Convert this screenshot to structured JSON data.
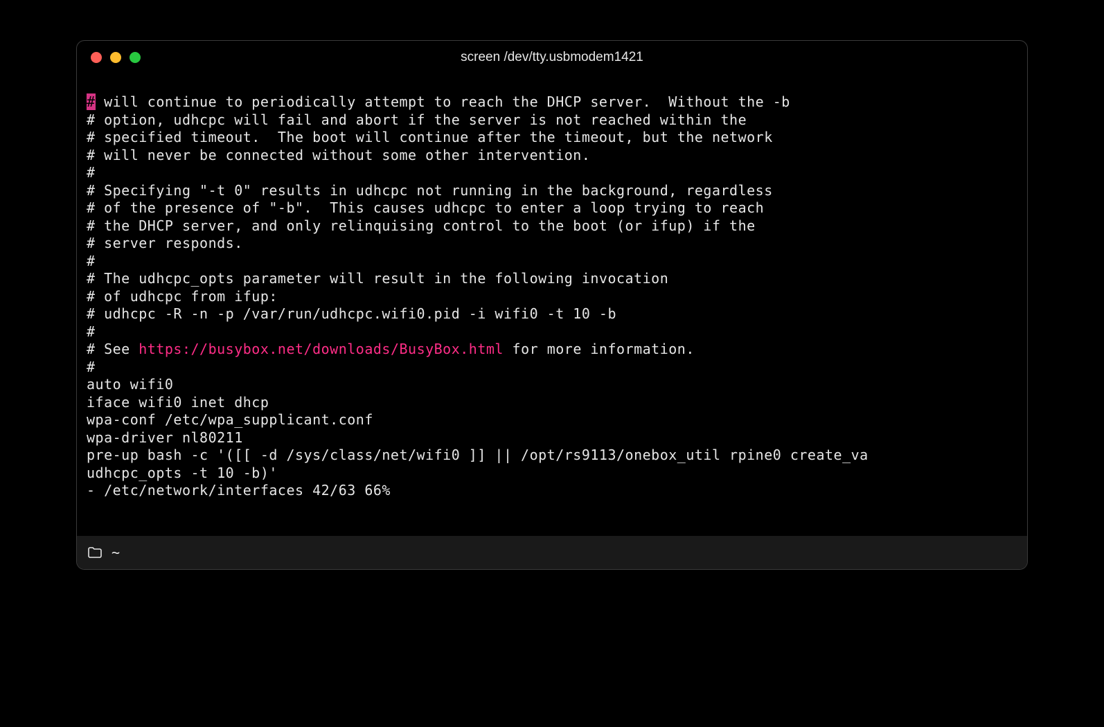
{
  "window": {
    "title": "screen /dev/tty.usbmodem1421"
  },
  "terminal": {
    "cursor_char": "#",
    "lines": [
      {
        "prefix": "",
        "text": " will continue to periodically attempt to reach the DHCP server.  Without the -b"
      },
      {
        "prefix": "",
        "text": "# option, udhcpc will fail and abort if the server is not reached within the"
      },
      {
        "prefix": "",
        "text": "# specified timeout.  The boot will continue after the timeout, but the network"
      },
      {
        "prefix": "",
        "text": "# will never be connected without some other intervention."
      },
      {
        "prefix": "",
        "text": "#"
      },
      {
        "prefix": "",
        "text": "# Specifying \"-t 0\" results in udhcpc not running in the background, regardless"
      },
      {
        "prefix": "",
        "text": "# of the presence of \"-b\".  This causes udhcpc to enter a loop trying to reach"
      },
      {
        "prefix": "",
        "text": "# the DHCP server, and only relinquising control to the boot (or ifup) if the"
      },
      {
        "prefix": "",
        "text": "# server responds."
      },
      {
        "prefix": "",
        "text": "#"
      },
      {
        "prefix": "",
        "text": "# The udhcpc_opts parameter will result in the following invocation"
      },
      {
        "prefix": "",
        "text": "# of udhcpc from ifup:"
      },
      {
        "prefix": "",
        "text": "# udhcpc -R -n -p /var/run/udhcpc.wifi0.pid -i wifi0 -t 10 -b"
      },
      {
        "prefix": "",
        "text": "#"
      }
    ],
    "link_line": {
      "prefix": "# See ",
      "url": "https://busybox.net/downloads/BusyBox.html",
      "suffix": " for more information."
    },
    "post_lines": [
      "#",
      "auto wifi0",
      "iface wifi0 inet dhcp",
      "wpa-conf /etc/wpa_supplicant.conf",
      "wpa-driver nl80211",
      "pre-up bash -c '([[ -d /sys/class/net/wifi0 ]] || /opt/rs9113/onebox_util rpine0 create_va",
      "udhcpc_opts -t 10 -b)'",
      "- /etc/network/interfaces 42/63 66%"
    ]
  },
  "statusbar": {
    "cwd": "~"
  }
}
